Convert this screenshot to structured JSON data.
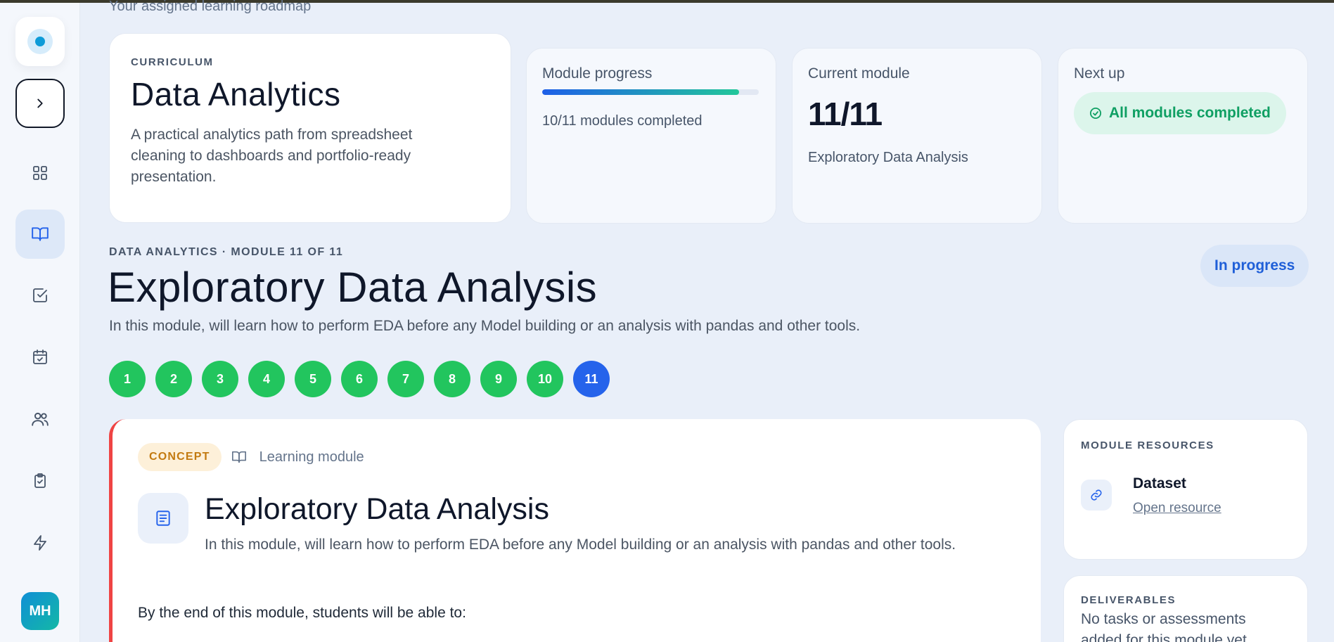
{
  "header": {
    "subtitle": "Your assigned learning roadmap"
  },
  "curriculum": {
    "eyebrow": "CURRICULUM",
    "title": "Data Analytics",
    "description": "A practical analytics path from spreadsheet cleaning to dashboards and portfolio-ready presentation."
  },
  "stats": {
    "progress": {
      "label": "Module progress",
      "fraction_complete": 0.909,
      "text": "10/11 modules completed"
    },
    "current": {
      "label": "Current module",
      "value": "11/11",
      "module_name": "Exploratory Data Analysis"
    },
    "next": {
      "label": "Next up",
      "status": "All modules completed",
      "status_icon": "check-circle-icon"
    }
  },
  "module": {
    "eyebrow": "DATA ANALYTICS · MODULE 11 OF 11",
    "title": "Exploratory Data Analysis",
    "description": "In this module, will learn how to perform EDA before any Model building or an analysis with pandas and other tools.",
    "status": "In progress",
    "steps": [
      {
        "label": "1",
        "state": "done"
      },
      {
        "label": "2",
        "state": "done"
      },
      {
        "label": "3",
        "state": "done"
      },
      {
        "label": "4",
        "state": "done"
      },
      {
        "label": "5",
        "state": "done"
      },
      {
        "label": "6",
        "state": "done"
      },
      {
        "label": "7",
        "state": "done"
      },
      {
        "label": "8",
        "state": "done"
      },
      {
        "label": "9",
        "state": "done"
      },
      {
        "label": "10",
        "state": "done"
      },
      {
        "label": "11",
        "state": "current"
      }
    ]
  },
  "concept": {
    "tag": "CONCEPT",
    "type_label": "Learning module",
    "title": "Exploratory Data Analysis",
    "description": "In this module, will learn how to perform EDA before any Model building or an analysis with pandas and other tools.",
    "outcome_intro": "By the end of this module, students will be able to:"
  },
  "resources": {
    "heading": "MODULE RESOURCES",
    "items": [
      {
        "name": "Dataset",
        "link_label": "Open resource",
        "icon": "link-icon"
      }
    ]
  },
  "deliverables": {
    "heading": "DELIVERABLES",
    "text": "No tasks or assessments added for this module yet."
  },
  "sidebar": {
    "items": [
      {
        "name": "dashboard",
        "icon": "grid-icon"
      },
      {
        "name": "curriculum",
        "icon": "book-icon",
        "active": true
      },
      {
        "name": "tasks",
        "icon": "check-square-icon"
      },
      {
        "name": "calendar",
        "icon": "calendar-check-icon"
      },
      {
        "name": "community",
        "icon": "users-icon"
      },
      {
        "name": "assessments",
        "icon": "clipboard-check-icon"
      },
      {
        "name": "activity",
        "icon": "zap-icon"
      }
    ],
    "avatar_initials": "MH"
  },
  "colors": {
    "accent": "#2563eb",
    "success": "#22c55e",
    "concept_border": "#ef4444",
    "concept_tag": "#c37a10"
  }
}
